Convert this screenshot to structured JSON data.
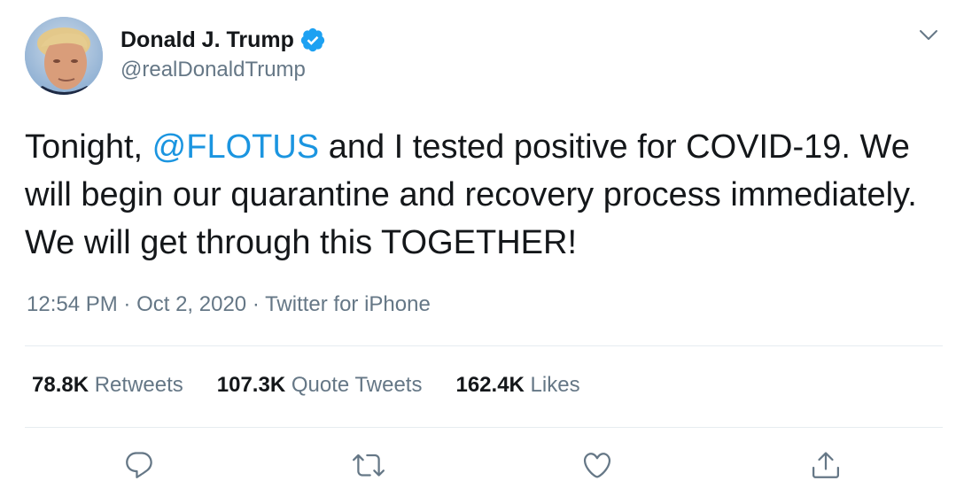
{
  "author": {
    "name": "Donald J. Trump",
    "handle": "@realDonaldTrump"
  },
  "tweet": {
    "text_before": "Tonight, ",
    "mention": "@FLOTUS",
    "text_after": " and I tested positive for COVID-19. We will begin our quarantine and recovery process immediately. We will get through this TOGETHER!",
    "time": "12:54 PM",
    "separator": "·",
    "date": "Oct 2, 2020",
    "source": "Twitter for iPhone"
  },
  "stats": [
    {
      "count": "78.8K",
      "label": "Retweets"
    },
    {
      "count": "107.3K",
      "label": "Quote Tweets"
    },
    {
      "count": "162.4K",
      "label": "Likes"
    }
  ],
  "colors": {
    "mention": "#1b95e0",
    "verified": "#1da1f2",
    "secondary_text": "#657786",
    "divider": "#e6ecf0"
  },
  "icons": {
    "verified": "verified-badge-icon",
    "caret": "chevron-down-icon",
    "reply": "reply-icon",
    "retweet": "retweet-icon",
    "like": "heart-icon",
    "share": "share-icon"
  }
}
